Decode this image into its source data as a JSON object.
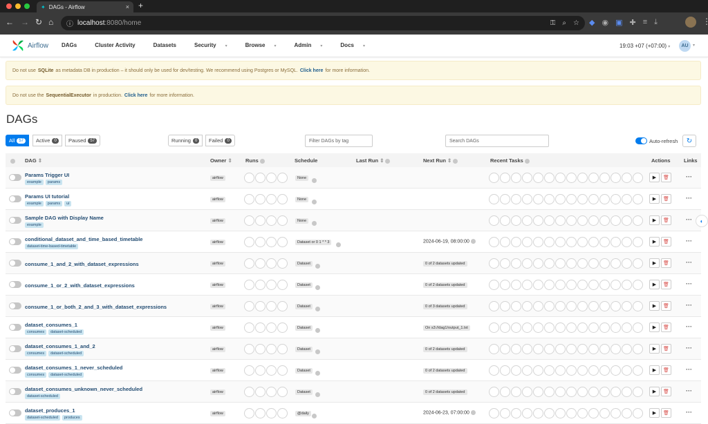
{
  "browser": {
    "tab_title": "DAGs - Airflow",
    "url_host": "localhost",
    "url_path": ":8080/home"
  },
  "app": {
    "logo_text": "Airflow",
    "menu": [
      "DAGs",
      "Cluster Activity",
      "Datasets",
      "Security",
      "Browse",
      "Admin",
      "Docs"
    ],
    "menu_dropdowns": [
      false,
      false,
      false,
      true,
      true,
      true,
      true
    ],
    "time": "19:03 +07 (+07:00)",
    "user_initials": "AU"
  },
  "alerts": {
    "a1_pre": "Do not use",
    "a1_bold": "SQLite",
    "a1_mid": "as metadata DB in production – it should only be used for dev/testing. We recommend using Postgres or MySQL.",
    "a1_link": "Click here",
    "a1_post": "for more information.",
    "a2_pre": "Do not use the",
    "a2_bold": "SequentialExecutor",
    "a2_mid": "in production.",
    "a2_link": "Click here",
    "a2_post": "for more information."
  },
  "page_title": "DAGs",
  "filters": {
    "all_label": "All",
    "all_count": "57",
    "active_label": "Active",
    "active_count": "0",
    "paused_label": "Paused",
    "paused_count": "57",
    "running_label": "Running",
    "running_count": "0",
    "failed_label": "Failed",
    "failed_count": "0",
    "tag_placeholder": "Filter DAGs by tag",
    "search_placeholder": "Search DAGs",
    "autorefresh_label": "Auto-refresh"
  },
  "columns": {
    "dag": "DAG",
    "owner": "Owner",
    "runs": "Runs",
    "schedule": "Schedule",
    "last_run": "Last Run",
    "next_run": "Next Run",
    "recent_tasks": "Recent Tasks",
    "actions": "Actions",
    "links": "Links"
  },
  "rows": [
    {
      "name": "Params Trigger UI",
      "tags": [
        "example",
        "params"
      ],
      "owner": "airflow",
      "schedule": "None",
      "next_run": "",
      "next_badge": ""
    },
    {
      "name": "Params UI tutorial",
      "tags": [
        "example",
        "params",
        "ui"
      ],
      "owner": "airflow",
      "schedule": "None",
      "next_run": "",
      "next_badge": ""
    },
    {
      "name": "Sample DAG with Display Name",
      "tags": [
        "example"
      ],
      "owner": "airflow",
      "schedule": "None",
      "next_run": "",
      "next_badge": ""
    },
    {
      "name": "conditional_dataset_and_time_based_timetable",
      "tags": [
        "dataset-time-based-timetable"
      ],
      "owner": "airflow",
      "schedule": "Dataset or 0 1 * * 3",
      "next_run": "2024-06-19, 08:00:00",
      "next_badge": ""
    },
    {
      "name": "consume_1_and_2_with_dataset_expressions",
      "tags": [],
      "owner": "airflow",
      "schedule": "Dataset",
      "next_run": "",
      "next_badge": "0 of 2 datasets updated"
    },
    {
      "name": "consume_1_or_2_with_dataset_expressions",
      "tags": [],
      "owner": "airflow",
      "schedule": "Dataset",
      "next_run": "",
      "next_badge": "0 of 2 datasets updated"
    },
    {
      "name": "consume_1_or_both_2_and_3_with_dataset_expressions",
      "tags": [],
      "owner": "airflow",
      "schedule": "Dataset",
      "next_run": "",
      "next_badge": "0 of 3 datasets updated"
    },
    {
      "name": "dataset_consumes_1",
      "tags": [
        "consumes",
        "dataset-scheduled"
      ],
      "owner": "airflow",
      "schedule": "Dataset",
      "next_run": "",
      "next_badge": "On s3://dag1/output_1.txt"
    },
    {
      "name": "dataset_consumes_1_and_2",
      "tags": [
        "consumes",
        "dataset-scheduled"
      ],
      "owner": "airflow",
      "schedule": "Dataset",
      "next_run": "",
      "next_badge": "0 of 2 datasets updated"
    },
    {
      "name": "dataset_consumes_1_never_scheduled",
      "tags": [
        "consumes",
        "dataset-scheduled"
      ],
      "owner": "airflow",
      "schedule": "Dataset",
      "next_run": "",
      "next_badge": "0 of 2 datasets updated"
    },
    {
      "name": "dataset_consumes_unknown_never_scheduled",
      "tags": [
        "dataset-scheduled"
      ],
      "owner": "airflow",
      "schedule": "Dataset",
      "next_run": "",
      "next_badge": "0 of 2 datasets updated"
    },
    {
      "name": "dataset_produces_1",
      "tags": [
        "dataset-scheduled",
        "produces"
      ],
      "owner": "airflow",
      "schedule": "@daily",
      "next_run": "2024-06-23, 07:00:00",
      "next_badge": ""
    }
  ]
}
